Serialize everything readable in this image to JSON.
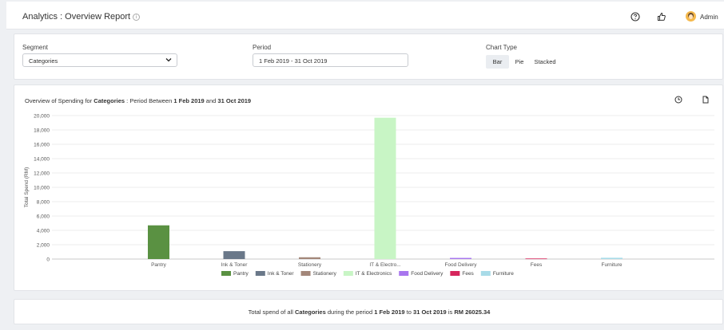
{
  "header": {
    "title": "Analytics : Overview Report",
    "user": "Admin"
  },
  "filters": {
    "segment_label": "Segment",
    "segment_value": "Categories",
    "period_label": "Period",
    "period_value": "1 Feb 2019 - 31 Oct 2019",
    "chart_type_label": "Chart Type",
    "chart_types": [
      "Bar",
      "Pie",
      "Stacked"
    ],
    "selected_chart_type": "Bar"
  },
  "chart_header": {
    "prefix": "Overview of Spending for ",
    "segment": "Categories",
    "mid": " : Period Between ",
    "start": "1 Feb 2019",
    "and": " and ",
    "end": "31 Oct 2019"
  },
  "chart_data": {
    "type": "bar",
    "categories": [
      "Pantry",
      "Ink & Toner",
      "Stationery",
      "IT & Electro...",
      "Food Delivery",
      "Fees",
      "Furniture"
    ],
    "values": [
      4700,
      1100,
      250,
      19700,
      160,
      80,
      180
    ],
    "colors": [
      "#5a9142",
      "#6a7889",
      "#a3877a",
      "#c8f5c5",
      "#a876ee",
      "#d6265c",
      "#a8dbe8"
    ],
    "ylabel": "Total Spend (RM)",
    "ylim": [
      0,
      20000
    ],
    "yticks": [
      "0",
      "2,000",
      "4,000",
      "6,000",
      "8,000",
      "10,000",
      "12,000",
      "14,000",
      "16,000",
      "18,000",
      "20,000"
    ],
    "legend": [
      "Pantry",
      "Ink & Toner",
      "Stationery",
      "IT & Electronics",
      "Food Delivery",
      "Fees",
      "Furniture"
    ],
    "legend_position": "bottom",
    "grid": true
  },
  "footer": {
    "t1": "Total spend of all ",
    "segment": "Categories",
    "t2": " during the period ",
    "start": "1 Feb 2019",
    "t3": " to ",
    "end": "31 Oct 2019",
    "t4": " is ",
    "total": "RM 26025.34"
  }
}
